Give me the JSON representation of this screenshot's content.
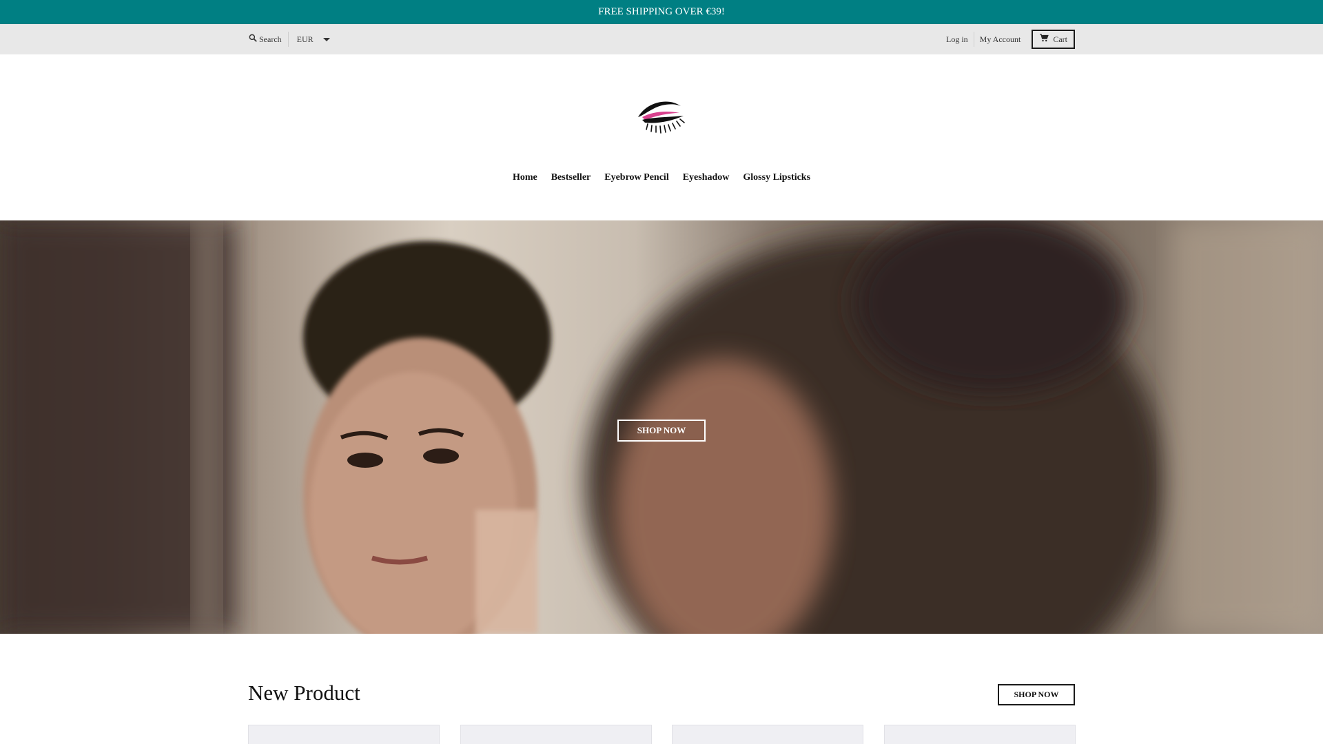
{
  "announcement": {
    "text": "FREE SHIPPING OVER €39!"
  },
  "utility": {
    "search_label": "Search",
    "currency": "EUR",
    "login_label": "Log in",
    "account_label": "My Account",
    "cart_label": "Cart"
  },
  "nav": {
    "items": [
      "Home",
      "Bestseller",
      "Eyebrow Pencil",
      "Eyeshadow",
      "Glossy Lipsticks"
    ]
  },
  "hero": {
    "button_label": "SHOP NOW"
  },
  "new_product": {
    "title": "New Product",
    "button_label": "SHOP NOW"
  },
  "colors": {
    "announcement_bg": "#007f83",
    "utility_bg": "#e8e8e8",
    "logo_pink": "#d9418e"
  }
}
